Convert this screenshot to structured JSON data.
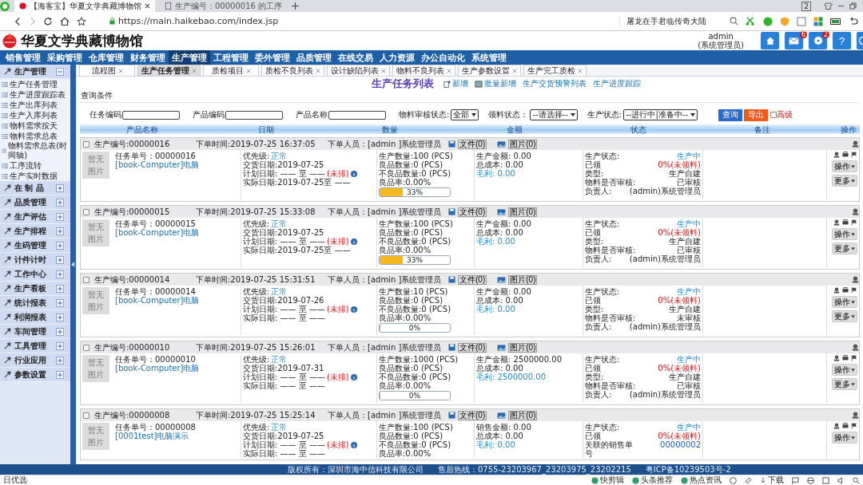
{
  "browser": {
    "tabs": [
      {
        "title": "【海客宝】华夏文学典藏博物馆",
        "selected": true
      },
      {
        "title": "生产编号：00000016  的工序",
        "selected": false
      }
    ],
    "window_badge": "2",
    "url": "https://main.haikebao.com/index.jsp",
    "search": "屠龙在手君临传奇大陆"
  },
  "header": {
    "title": "华夏文学典藏博物馆",
    "user": "admin",
    "role": "(系统管理员)",
    "mail_count": "6",
    "chat_count": "2",
    "help": "?"
  },
  "nav": [
    {
      "label": "销售管理",
      "selected": false
    },
    {
      "label": "采购管理",
      "selected": false
    },
    {
      "label": "仓库管理",
      "selected": false
    },
    {
      "label": "财务管理",
      "selected": false
    },
    {
      "label": "生产管理",
      "selected": true
    },
    {
      "label": "工程管理",
      "selected": false
    },
    {
      "label": "委外管理",
      "selected": false
    },
    {
      "label": "品质管理",
      "selected": false
    },
    {
      "label": "在线交易",
      "selected": false
    },
    {
      "label": "人力资源",
      "selected": false
    },
    {
      "label": "办公自动化",
      "selected": false
    },
    {
      "label": "系统管理",
      "selected": false
    }
  ],
  "sidebar": [
    {
      "label": "生产管理",
      "expanded": true,
      "children": [
        "生产任务管理",
        "生产进度跟踪表",
        "生产出库列表",
        "生产入库列表",
        "物料需求按天",
        "物料需求总表",
        "物料需求总表(时间轴)",
        "工序流转",
        "生产实时数据"
      ]
    },
    {
      "label": "在 制 品",
      "expanded": false
    },
    {
      "label": "品质管理",
      "expanded": false
    },
    {
      "label": "生产评估",
      "expanded": false
    },
    {
      "label": "生产排程",
      "expanded": false
    },
    {
      "label": "生码管理",
      "expanded": false
    },
    {
      "label": "计件计时",
      "expanded": false
    },
    {
      "label": "工作中心",
      "expanded": false
    },
    {
      "label": "生产看板",
      "expanded": false
    },
    {
      "label": "统计报表",
      "expanded": false
    },
    {
      "label": "利润报表",
      "expanded": false
    },
    {
      "label": "车间管理",
      "expanded": false
    },
    {
      "label": "工具管理",
      "expanded": false
    },
    {
      "label": "行业应用",
      "expanded": false
    },
    {
      "label": "参数设置",
      "expanded": false
    }
  ],
  "page_tabs": [
    {
      "label": "流程图",
      "selected": false
    },
    {
      "label": "生产任务管理",
      "selected": true
    },
    {
      "label": "质检项目",
      "selected": false
    },
    {
      "label": "质检不良列表",
      "selected": false
    },
    {
      "label": "设计缺陷列表",
      "selected": false
    },
    {
      "label": "物料不良列表",
      "selected": false
    },
    {
      "label": "生产参数设置",
      "selected": false
    },
    {
      "label": "生产完工质检",
      "selected": false
    }
  ],
  "page_title": "生产任务列表",
  "toolbar_links": [
    "新增",
    "批量新增",
    "生产交货预警列表",
    "生产进度跟踪"
  ],
  "query_label": "查询条件",
  "filters": {
    "task_code": "任务编码",
    "product_code": "产品编码",
    "product_name": "产品名称",
    "material_review": {
      "label": "物料审核状态:",
      "value": "全部"
    },
    "picking": {
      "label": "领料状态：",
      "value": "--请选择--"
    },
    "production": {
      "label": "生产状态:",
      "value": "--进行中|准备中--"
    },
    "query_button": "查询",
    "export_button": "导出",
    "advanced": {
      "label": "高级",
      "checked": false
    }
  },
  "columns": [
    "产品名称",
    "日期",
    "数量",
    "金额",
    "状态",
    "备注",
    "操作"
  ],
  "cards": [
    {
      "checked": false,
      "code": "生产编号:00000016",
      "order_time": "下单时间:2019-07-25 16:37:05",
      "orderer": "下单人员：[admin ]系统管理员",
      "file": "文件(0)",
      "images": "图片(0)",
      "no_image": "暂无图片",
      "task_no": "任务单号：00000016",
      "product": "[book-Computer]电脑",
      "priority_label": "优先级:",
      "priority": "正常",
      "delivery": "交货日期:2019-07-25",
      "plan": "计划日期: —— 至 ——",
      "plan_state": "(未排)",
      "actual": "实际日期:2019-07-25至 ——",
      "quantities": [
        "生产数量:100 (PCS)",
        "良品数量:0 (PCS)",
        "不良品数量:0 (PCS)",
        "良品率:0.00%"
      ],
      "progress": {
        "level": 0.33,
        "label": "33%"
      },
      "amounts": [
        {
          "text": "生产金额: 0.00",
          "kind": "plain"
        },
        {
          "text": "总成本: 0.00",
          "kind": "plain"
        },
        {
          "text": "毛利: 0.00",
          "kind": "link"
        }
      ],
      "status": [
        {
          "label": "生产状态:",
          "value": "生产中",
          "kind": "status"
        },
        {
          "label": "已领",
          "value": "0%(未领料)",
          "kind": "alert"
        },
        {
          "label": "类型:",
          "value": "生产自建",
          "kind": "plain"
        },
        {
          "label": "物料是否审核:",
          "value": "已审核",
          "kind": "plain"
        },
        {
          "label": "负责人:",
          "value": "(admin)系统管理员",
          "kind": "plain"
        }
      ],
      "actions": [
        "操作",
        "更多"
      ]
    },
    {
      "checked": false,
      "code": "生产编号:00000015",
      "order_time": "下单时间:2019-07-25 15:33:08",
      "orderer": "下单人员：[admin ]系统管理员",
      "file": "文件(0)",
      "images": "图片(0)",
      "no_image": "暂无图片",
      "task_no": "任务单号：00000015",
      "product": "[book-Computer]电脑",
      "priority_label": "优先级:",
      "priority": "正常",
      "delivery": "交货日期:2019-07-25",
      "plan": "计划日期: —— 至 ——",
      "plan_state": "(未排)",
      "actual": "实际日期:2019-07-25至 ——",
      "quantities": [
        "生产数量:100 (PCS)",
        "良品数量:0 (PCS)",
        "不良品数量:0 (PCS)",
        "良品率:0.00%"
      ],
      "progress": {
        "level": 0.33,
        "label": "33%"
      },
      "amounts": [
        {
          "text": "生产金额: 0.00",
          "kind": "plain"
        },
        {
          "text": "总成本: 0.00",
          "kind": "plain"
        },
        {
          "text": "毛利: 0.00",
          "kind": "link"
        }
      ],
      "status": [
        {
          "label": "生产状态:",
          "value": "生产中",
          "kind": "status"
        },
        {
          "label": "已领",
          "value": "0%(未领料)",
          "kind": "alert"
        },
        {
          "label": "类型:",
          "value": "生产自建",
          "kind": "plain"
        },
        {
          "label": "物料是否审核:",
          "value": "已审核",
          "kind": "plain"
        },
        {
          "label": "负责人:",
          "value": "(admin)系统管理员",
          "kind": "plain"
        }
      ],
      "actions": [
        "操作",
        "更多"
      ]
    },
    {
      "checked": false,
      "code": "生产编号:00000014",
      "order_time": "下单时间:2019-07-25 15:31:51",
      "orderer": "下单人员：[admin ]系统管理员",
      "file": "文件(0)",
      "images": "图片(0)",
      "no_image": "暂无图片",
      "task_no": "任务单号：00000014",
      "product": "[book-Computer]电脑",
      "priority_label": "优先级:",
      "priority": "正常",
      "delivery": "交货日期:2019-07-26",
      "plan": "计划日期: —— 至 ——",
      "plan_state": "(未排)",
      "actual": "实际日期: —— 至 ——",
      "quantities": [
        "生产数量:10 (PCS)",
        "良品数量:0 (PCS)",
        "不良品数量:0 (PCS)",
        "良品率:0.00%"
      ],
      "progress": {
        "level": 0,
        "label": "0%"
      },
      "amounts": [
        {
          "text": "生产金额: 0.00",
          "kind": "plain"
        },
        {
          "text": "总成本: 0.00",
          "kind": "plain"
        },
        {
          "text": "毛利: 0.00",
          "kind": "link"
        }
      ],
      "status": [
        {
          "label": "生产状态:",
          "value": "生产中",
          "kind": "status"
        },
        {
          "label": "已领",
          "value": "0%(未领料)",
          "kind": "alert"
        },
        {
          "label": "类型:",
          "value": "生产自建",
          "kind": "plain"
        },
        {
          "label": "物料是否审核:",
          "value": "未审核",
          "kind": "plain"
        },
        {
          "label": "负责人:",
          "value": "(admin)系统管理员",
          "kind": "plain"
        }
      ],
      "actions": [
        "操作",
        "更多"
      ]
    },
    {
      "checked": false,
      "code": "生产编号:00000010",
      "order_time": "下单时间:2019-07-25 15:26:01",
      "orderer": "下单人员：[admin ]系统管理员",
      "file": "文件(0)",
      "images": "图片(0)",
      "no_image": "暂无图片",
      "task_no": "任务单号：00000010",
      "product": "[book-Computer]电脑",
      "priority_label": "优先级:",
      "priority": "正常",
      "delivery": "交货日期:2019-07-31",
      "plan": "计划日期: —— 至 ——",
      "plan_state": "(未排)",
      "actual": "实际日期: —— 至 ——",
      "quantities": [
        "生产数量:1000 (PCS)",
        "良品数量:0 (PCS)",
        "不良品数量:0 (PCS)",
        "良品率:0.00%"
      ],
      "progress": {
        "level": 0,
        "label": "0%"
      },
      "amounts": [
        {
          "text": "生产金额: 2500000.00",
          "kind": "plain"
        },
        {
          "text": "总成本: 0.00",
          "kind": "plain"
        },
        {
          "text": "毛利: 2500000.00",
          "kind": "link"
        }
      ],
      "status": [
        {
          "label": "生产状态:",
          "value": "生产中",
          "kind": "status"
        },
        {
          "label": "已领",
          "value": "0%(未领料)",
          "kind": "alert"
        },
        {
          "label": "类型:",
          "value": "生产自建",
          "kind": "plain"
        },
        {
          "label": "物料是否审核:",
          "value": "已审核",
          "kind": "plain"
        },
        {
          "label": "负责人:",
          "value": "(admin)系统管理员",
          "kind": "plain"
        }
      ],
      "actions": [
        "操作",
        "更多"
      ]
    },
    {
      "checked": false,
      "code": "生产编号:00000008",
      "order_time": "下单时间:2019-07-25 15:25:14",
      "orderer": "下单人员：[admin ]系统管理员",
      "file": "文件(0)",
      "images": "图片(0)",
      "no_image": "暂无图片",
      "task_no": "任务单号：00000008",
      "product": "[0001test]电脑演示",
      "priority_label": "优先级:",
      "priority": "正常",
      "delivery": "交货日期:2019-07-25",
      "plan": "计划日期: —— 至 ——",
      "plan_state": "(未排)",
      "actual": "实际日期: —— 至 ——",
      "quantities": [
        "生产数量:100 (PCS)",
        "良品数量:0 (PCS)",
        "不良品数量:0 (PCS)",
        "良品率:0.00%"
      ],
      "amounts": [
        {
          "text": "销售金额: 0.00",
          "kind": "plain"
        },
        {
          "text": "总成本: 0.00",
          "kind": "plain"
        },
        {
          "text": "毛利: 0.00",
          "kind": "link"
        }
      ],
      "status": [
        {
          "label": "生产状态:",
          "value": "生产中",
          "kind": "status"
        },
        {
          "label": "已领",
          "value": "0%(未领料)",
          "kind": "alert"
        },
        {
          "label": "关联的销售单号",
          "value": "00000002",
          "kind": "link"
        }
      ],
      "actions": [
        "操作"
      ]
    }
  ],
  "footer": {
    "copyright": "版权所有：深圳市海中信科技有限公司",
    "hotline": "售后热线：0755-23203967_23203975_23202215",
    "icp": "粤ICP备10239503号-2"
  },
  "statusbar": {
    "left": "日优选",
    "items": [
      "快剪辑",
      "头条推荐",
      "热点资讯"
    ],
    "download": "下载"
  }
}
